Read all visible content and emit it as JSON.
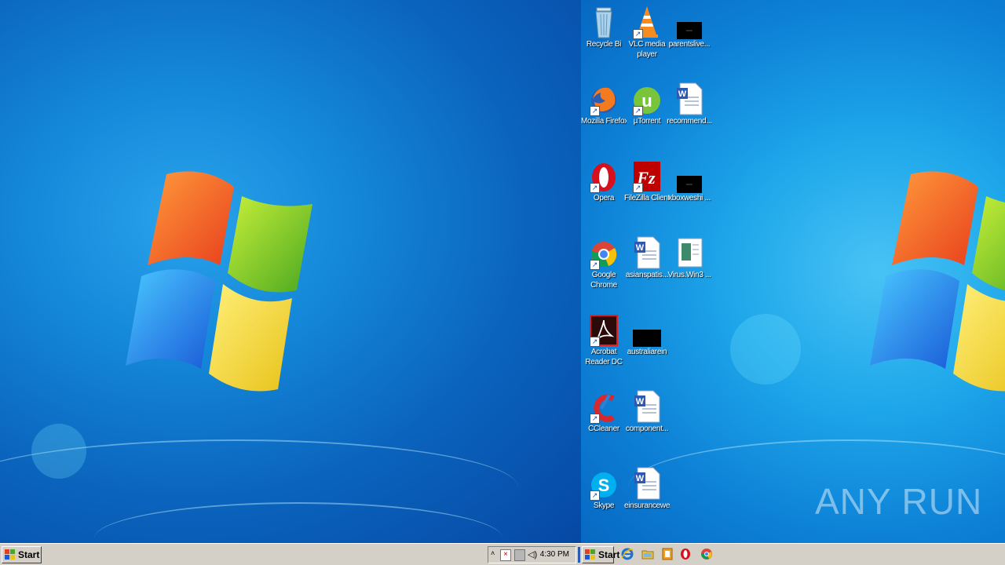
{
  "desktop_icons": {
    "recycle_bin": "Recycle Bi",
    "vlc": "VLC media player",
    "parentslive": "parentslive...",
    "firefox": "Mozilla Firefox",
    "utorrent": "µTorrent",
    "recommend": "recommend...",
    "opera": "Opera",
    "filezilla": "FileZilla Client",
    "xboxweshi": "xboxweshi ...",
    "chrome": "Google Chrome",
    "asianspa": "asianspatis...",
    "virus": "Virus.Win3 ...",
    "acrobat": "Acrobat Reader DC",
    "australia": "australiarein",
    "ccleaner": "CCleaner",
    "component": "component...",
    "skype": "Skype",
    "einsurance": "einsuranceweff"
  },
  "taskbar": {
    "start_label": "Start",
    "clock": "4:30 PM"
  },
  "watermark": "ANY RUN",
  "colors": {
    "taskbar": "#d4d0c8",
    "desktop_left": "#0a63bc",
    "desktop_right": "#1ea7ea"
  }
}
